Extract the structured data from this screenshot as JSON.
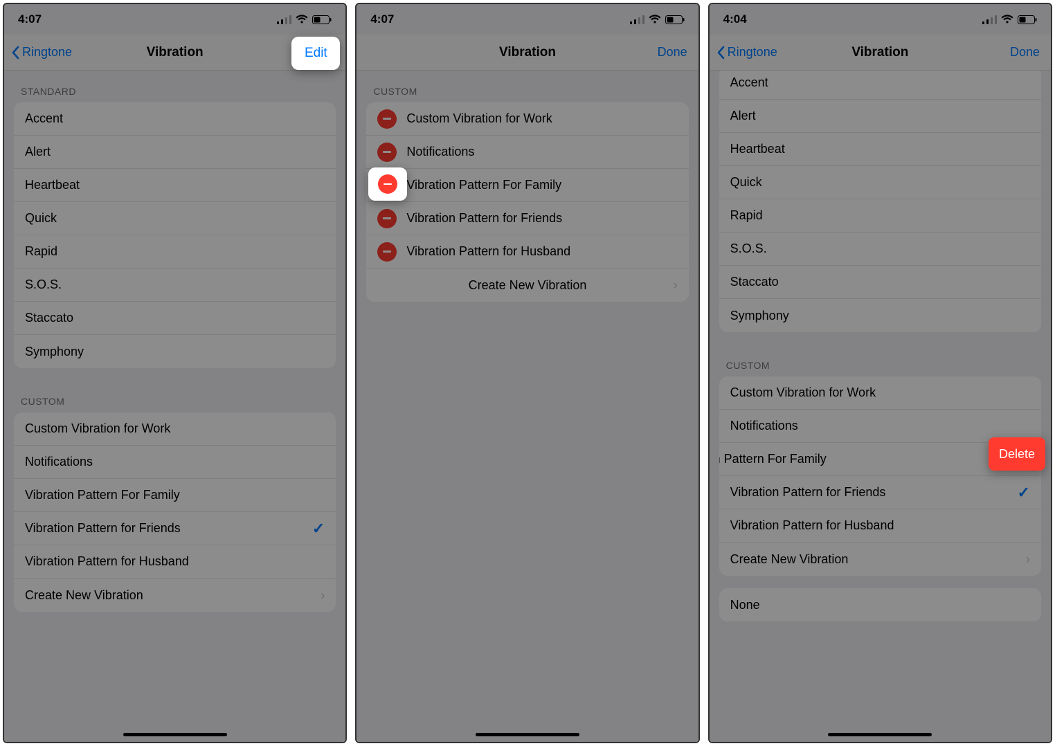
{
  "colors": {
    "blue": "#007aff",
    "red": "#ff3b30"
  },
  "status": {
    "time_a": "4:07",
    "time_b": "4:07",
    "time_c": "4:04"
  },
  "nav": {
    "back_label": "Ringtone",
    "title": "Vibration",
    "edit": "Edit",
    "done": "Done"
  },
  "sections": {
    "standard": "Standard",
    "custom": "Custom"
  },
  "standard_items": [
    "Accent",
    "Alert",
    "Heartbeat",
    "Quick",
    "Rapid",
    "S.O.S.",
    "Staccato",
    "Symphony"
  ],
  "custom_items": [
    "Custom Vibration for Work",
    "Notifications",
    "Vibration Pattern For Family",
    "Vibration Pattern for Friends",
    "Vibration Pattern for Husband"
  ],
  "create_new": "Create New Vibration",
  "none": "None",
  "selected_custom": "Vibration Pattern for Friends",
  "swiped_row_label": "n Pattern For Family",
  "delete_label": "Delete"
}
